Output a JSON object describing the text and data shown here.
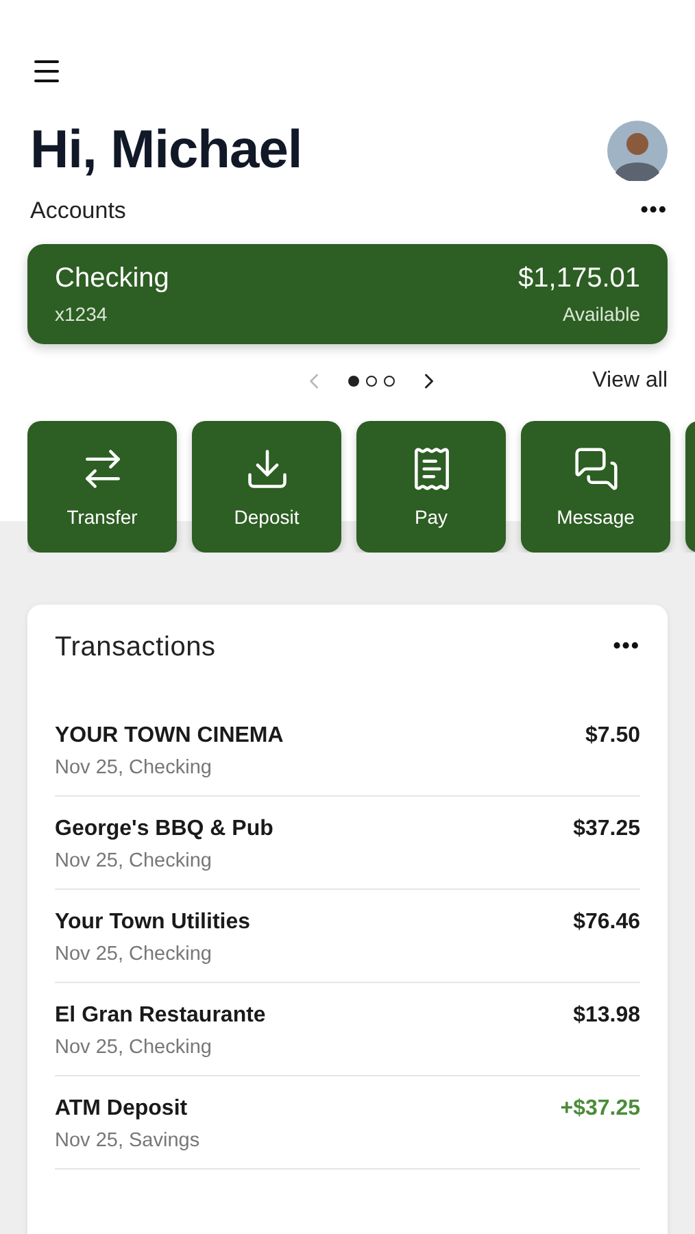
{
  "greeting": "Hi, Michael",
  "accounts": {
    "title": "Accounts",
    "menu": "•••",
    "view_all": "View all",
    "card": {
      "name": "Checking",
      "number": "x1234",
      "balance": "$1,175.01",
      "balance_label": "Available"
    },
    "pager": [
      {
        "selected": true
      },
      {
        "selected": false
      },
      {
        "selected": false
      }
    ]
  },
  "actions": [
    {
      "label": "Transfer"
    },
    {
      "label": "Deposit"
    },
    {
      "label": "Pay"
    },
    {
      "label": "Message"
    }
  ],
  "transactions": {
    "title": "Transactions",
    "menu": "•••",
    "rows": [
      {
        "payee": "YOUR TOWN CINEMA",
        "detail": "Nov 25, Checking",
        "amount": "$7.50",
        "kind": "debit"
      },
      {
        "payee": "George's BBQ & Pub",
        "detail": "Nov 25, Checking",
        "amount": "$37.25",
        "kind": "debit"
      },
      {
        "payee": "Your Town Utilities",
        "detail": "Nov 25, Checking",
        "amount": "$76.46",
        "kind": "debit"
      },
      {
        "payee": "El Gran Restaurante",
        "detail": "Nov 25, Checking",
        "amount": "$13.98",
        "kind": "debit"
      },
      {
        "payee": "ATM Deposit",
        "detail": "Nov 25, Savings",
        "amount": "+$37.25",
        "kind": "credit"
      }
    ]
  }
}
